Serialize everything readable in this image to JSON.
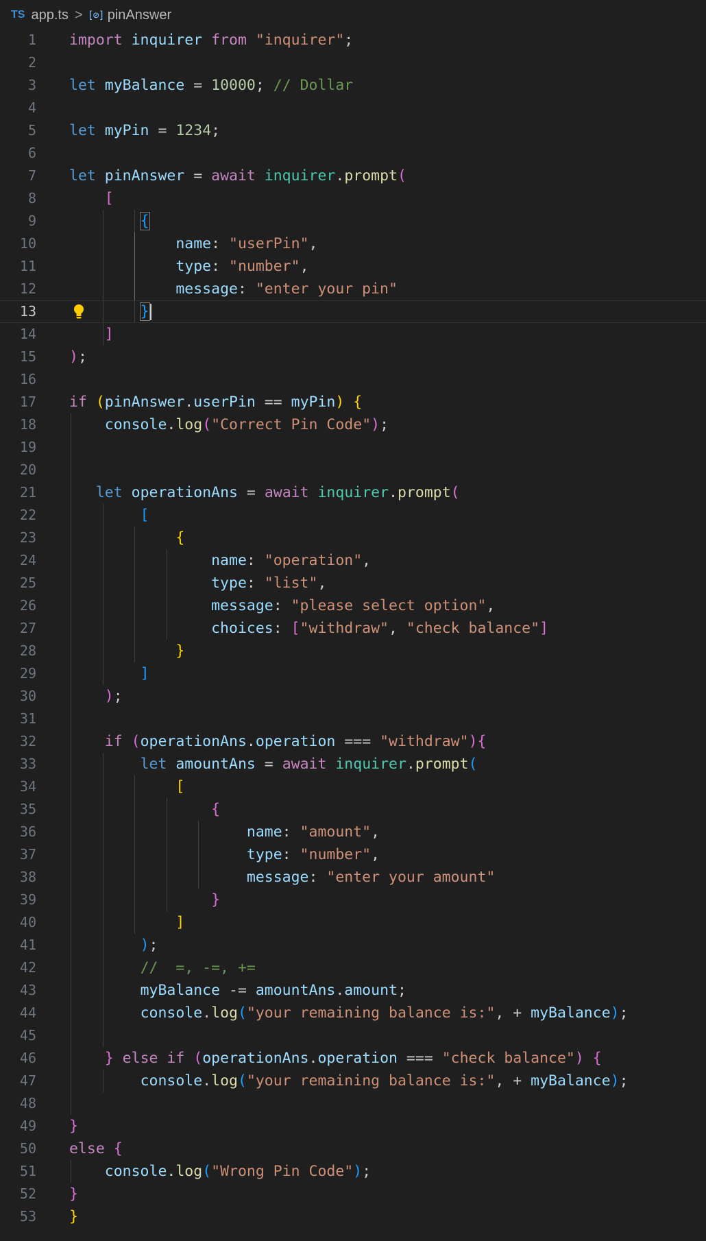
{
  "breadcrumb": {
    "file_icon": "TS",
    "file_name": "app.ts",
    "separator": ">",
    "symbol_icon": "[⊘]",
    "symbol_name": "pinAnswer"
  },
  "editor": {
    "current_line": 13,
    "colors": {
      "background": "#1f1f1f",
      "keyword": "#569cd6",
      "control": "#c586c0",
      "variable": "#9cdcfe",
      "function": "#dcdcaa",
      "type": "#4ec9b0",
      "string": "#ce9178",
      "number": "#b5cea8",
      "comment": "#6a9955",
      "bracket_gold": "#ffd700",
      "bracket_pink": "#da70d6",
      "bracket_blue": "#179fff"
    },
    "lines": [
      {
        "n": "1",
        "tokens": [
          [
            "import ",
            "c"
          ],
          [
            "inquirer ",
            "v"
          ],
          [
            "from ",
            "c"
          ],
          [
            "\"inquirer\"",
            "s"
          ],
          [
            ";",
            "p"
          ]
        ]
      },
      {
        "n": "2",
        "tokens": []
      },
      {
        "n": "3",
        "tokens": [
          [
            "let ",
            "k"
          ],
          [
            "myBalance",
            "v"
          ],
          [
            " = ",
            "p"
          ],
          [
            "10000",
            "n"
          ],
          [
            "; ",
            "p"
          ],
          [
            "// Dollar",
            "m"
          ]
        ]
      },
      {
        "n": "4",
        "tokens": []
      },
      {
        "n": "5",
        "tokens": [
          [
            "let ",
            "k"
          ],
          [
            "myPin",
            "v"
          ],
          [
            " = ",
            "p"
          ],
          [
            "1234",
            "n"
          ],
          [
            ";",
            "p"
          ]
        ]
      },
      {
        "n": "6",
        "tokens": []
      },
      {
        "n": "7",
        "tokens": [
          [
            "let ",
            "k"
          ],
          [
            "pinAnswer",
            "v"
          ],
          [
            " = ",
            "p"
          ],
          [
            "await ",
            "c"
          ],
          [
            "inquirer",
            "t"
          ],
          [
            ".",
            "p"
          ],
          [
            "prompt",
            "f"
          ],
          [
            "(",
            "b2"
          ]
        ]
      },
      {
        "n": "8",
        "tokens": [
          [
            "    ",
            "p"
          ],
          [
            "[",
            "b2"
          ]
        ]
      },
      {
        "n": "9",
        "tokens": [
          [
            "        ",
            "p"
          ],
          [
            "{",
            "b3box"
          ]
        ]
      },
      {
        "n": "10",
        "tokens": [
          [
            "            ",
            "p"
          ],
          [
            "name",
            "v"
          ],
          [
            ": ",
            "p"
          ],
          [
            "\"userPin\"",
            "s"
          ],
          [
            ",",
            "p"
          ]
        ]
      },
      {
        "n": "11",
        "tokens": [
          [
            "            ",
            "p"
          ],
          [
            "type",
            "v"
          ],
          [
            ": ",
            "p"
          ],
          [
            "\"number\"",
            "s"
          ],
          [
            ",",
            "p"
          ]
        ]
      },
      {
        "n": "12",
        "tokens": [
          [
            "            ",
            "p"
          ],
          [
            "message",
            "v"
          ],
          [
            ": ",
            "p"
          ],
          [
            "\"enter your pin\"",
            "s"
          ]
        ]
      },
      {
        "n": "13",
        "tokens": [
          [
            "        ",
            "p"
          ],
          [
            "}",
            "b3box"
          ],
          [
            "",
            "cursor"
          ]
        ]
      },
      {
        "n": "14",
        "tokens": [
          [
            "    ",
            "p"
          ],
          [
            "]",
            "b2"
          ]
        ]
      },
      {
        "n": "15",
        "tokens": [
          [
            ")",
            "b2"
          ],
          [
            ";",
            "p"
          ]
        ]
      },
      {
        "n": "16",
        "tokens": []
      },
      {
        "n": "17",
        "tokens": [
          [
            "if ",
            "c"
          ],
          [
            "(",
            "b1"
          ],
          [
            "pinAnswer",
            "v"
          ],
          [
            ".",
            "p"
          ],
          [
            "userPin",
            "v"
          ],
          [
            " == ",
            "p"
          ],
          [
            "myPin",
            "v"
          ],
          [
            ")",
            "b1"
          ],
          [
            " ",
            "p"
          ],
          [
            "{",
            "b1"
          ]
        ]
      },
      {
        "n": "18",
        "tokens": [
          [
            "    ",
            "p"
          ],
          [
            "console",
            "v"
          ],
          [
            ".",
            "p"
          ],
          [
            "log",
            "f"
          ],
          [
            "(",
            "b2"
          ],
          [
            "\"Correct Pin Code\"",
            "s"
          ],
          [
            ")",
            "b2"
          ],
          [
            ";",
            "p"
          ]
        ]
      },
      {
        "n": "19",
        "tokens": []
      },
      {
        "n": "20",
        "tokens": []
      },
      {
        "n": "21",
        "tokens": [
          [
            "   ",
            "p"
          ],
          [
            "let ",
            "k"
          ],
          [
            "operationAns",
            "v"
          ],
          [
            " = ",
            "p"
          ],
          [
            "await ",
            "c"
          ],
          [
            "inquirer",
            "t"
          ],
          [
            ".",
            "p"
          ],
          [
            "prompt",
            "f"
          ],
          [
            "(",
            "b2"
          ]
        ]
      },
      {
        "n": "22",
        "tokens": [
          [
            "        ",
            "p"
          ],
          [
            "[",
            "b3"
          ]
        ]
      },
      {
        "n": "23",
        "tokens": [
          [
            "            ",
            "p"
          ],
          [
            "{",
            "b1"
          ]
        ]
      },
      {
        "n": "24",
        "tokens": [
          [
            "                ",
            "p"
          ],
          [
            "name",
            "v"
          ],
          [
            ": ",
            "p"
          ],
          [
            "\"operation\"",
            "s"
          ],
          [
            ",",
            "p"
          ]
        ]
      },
      {
        "n": "25",
        "tokens": [
          [
            "                ",
            "p"
          ],
          [
            "type",
            "v"
          ],
          [
            ": ",
            "p"
          ],
          [
            "\"list\"",
            "s"
          ],
          [
            ",",
            "p"
          ]
        ]
      },
      {
        "n": "26",
        "tokens": [
          [
            "                ",
            "p"
          ],
          [
            "message",
            "v"
          ],
          [
            ": ",
            "p"
          ],
          [
            "\"please select option\"",
            "s"
          ],
          [
            ",",
            "p"
          ]
        ]
      },
      {
        "n": "27",
        "tokens": [
          [
            "                ",
            "p"
          ],
          [
            "choices",
            "v"
          ],
          [
            ": ",
            "p"
          ],
          [
            "[",
            "b2"
          ],
          [
            "\"withdraw\"",
            "s"
          ],
          [
            ", ",
            "p"
          ],
          [
            "\"check balance\"",
            "s"
          ],
          [
            "]",
            "b2"
          ]
        ]
      },
      {
        "n": "28",
        "tokens": [
          [
            "            ",
            "p"
          ],
          [
            "}",
            "b1"
          ]
        ]
      },
      {
        "n": "29",
        "tokens": [
          [
            "        ",
            "p"
          ],
          [
            "]",
            "b3"
          ]
        ]
      },
      {
        "n": "30",
        "tokens": [
          [
            "    ",
            "p"
          ],
          [
            ")",
            "b2"
          ],
          [
            ";",
            "p"
          ]
        ]
      },
      {
        "n": "31",
        "tokens": []
      },
      {
        "n": "32",
        "tokens": [
          [
            "    ",
            "p"
          ],
          [
            "if ",
            "c"
          ],
          [
            "(",
            "b2"
          ],
          [
            "operationAns",
            "v"
          ],
          [
            ".",
            "p"
          ],
          [
            "operation",
            "v"
          ],
          [
            " === ",
            "p"
          ],
          [
            "\"withdraw\"",
            "s"
          ],
          [
            ")",
            "b2"
          ],
          [
            "{",
            "b2"
          ]
        ]
      },
      {
        "n": "33",
        "tokens": [
          [
            "        ",
            "p"
          ],
          [
            "let ",
            "k"
          ],
          [
            "amountAns",
            "v"
          ],
          [
            " = ",
            "p"
          ],
          [
            "await ",
            "c"
          ],
          [
            "inquirer",
            "t"
          ],
          [
            ".",
            "p"
          ],
          [
            "prompt",
            "f"
          ],
          [
            "(",
            "b3"
          ]
        ]
      },
      {
        "n": "34",
        "tokens": [
          [
            "            ",
            "p"
          ],
          [
            "[",
            "b1"
          ]
        ]
      },
      {
        "n": "35",
        "tokens": [
          [
            "                ",
            "p"
          ],
          [
            "{",
            "b2"
          ]
        ]
      },
      {
        "n": "36",
        "tokens": [
          [
            "                    ",
            "p"
          ],
          [
            "name",
            "v"
          ],
          [
            ": ",
            "p"
          ],
          [
            "\"amount\"",
            "s"
          ],
          [
            ",",
            "p"
          ]
        ]
      },
      {
        "n": "37",
        "tokens": [
          [
            "                    ",
            "p"
          ],
          [
            "type",
            "v"
          ],
          [
            ": ",
            "p"
          ],
          [
            "\"number\"",
            "s"
          ],
          [
            ",",
            "p"
          ]
        ]
      },
      {
        "n": "38",
        "tokens": [
          [
            "                    ",
            "p"
          ],
          [
            "message",
            "v"
          ],
          [
            ": ",
            "p"
          ],
          [
            "\"enter your amount\"",
            "s"
          ]
        ]
      },
      {
        "n": "39",
        "tokens": [
          [
            "                ",
            "p"
          ],
          [
            "}",
            "b2"
          ]
        ]
      },
      {
        "n": "40",
        "tokens": [
          [
            "            ",
            "p"
          ],
          [
            "]",
            "b1"
          ]
        ]
      },
      {
        "n": "41",
        "tokens": [
          [
            "        ",
            "p"
          ],
          [
            ")",
            "b3"
          ],
          [
            ";",
            "p"
          ]
        ]
      },
      {
        "n": "42",
        "tokens": [
          [
            "        ",
            "p"
          ],
          [
            "//  =, -=, +=",
            "m"
          ]
        ]
      },
      {
        "n": "43",
        "tokens": [
          [
            "        ",
            "p"
          ],
          [
            "myBalance",
            "v"
          ],
          [
            " -= ",
            "p"
          ],
          [
            "amountAns",
            "v"
          ],
          [
            ".",
            "p"
          ],
          [
            "amount",
            "v"
          ],
          [
            ";",
            "p"
          ]
        ]
      },
      {
        "n": "44",
        "tokens": [
          [
            "        ",
            "p"
          ],
          [
            "console",
            "v"
          ],
          [
            ".",
            "p"
          ],
          [
            "log",
            "f"
          ],
          [
            "(",
            "b3"
          ],
          [
            "\"your remaining balance is:\"",
            "s"
          ],
          [
            ", + ",
            "p"
          ],
          [
            "myBalance",
            "v"
          ],
          [
            ")",
            "b3"
          ],
          [
            ";",
            "p"
          ]
        ]
      },
      {
        "n": "45",
        "tokens": []
      },
      {
        "n": "46",
        "tokens": [
          [
            "    ",
            "p"
          ],
          [
            "}",
            "b2"
          ],
          [
            " else if ",
            "c"
          ],
          [
            "(",
            "b2"
          ],
          [
            "operationAns",
            "v"
          ],
          [
            ".",
            "p"
          ],
          [
            "operation",
            "v"
          ],
          [
            " === ",
            "p"
          ],
          [
            "\"check balance\"",
            "s"
          ],
          [
            ")",
            "b2"
          ],
          [
            " ",
            "p"
          ],
          [
            "{",
            "b2"
          ]
        ]
      },
      {
        "n": "47",
        "tokens": [
          [
            "        ",
            "p"
          ],
          [
            "console",
            "v"
          ],
          [
            ".",
            "p"
          ],
          [
            "log",
            "f"
          ],
          [
            "(",
            "b3"
          ],
          [
            "\"your remaining balance is:\"",
            "s"
          ],
          [
            ", + ",
            "p"
          ],
          [
            "myBalance",
            "v"
          ],
          [
            ")",
            "b3"
          ],
          [
            ";",
            "p"
          ]
        ]
      },
      {
        "n": "48",
        "tokens": []
      },
      {
        "n": "49",
        "tokens": [
          [
            "}",
            "b2"
          ]
        ]
      },
      {
        "n": "50",
        "tokens": [
          [
            "else ",
            "c"
          ],
          [
            "{",
            "b2"
          ]
        ]
      },
      {
        "n": "51",
        "tokens": [
          [
            "    ",
            "p"
          ],
          [
            "console",
            "v"
          ],
          [
            ".",
            "p"
          ],
          [
            "log",
            "f"
          ],
          [
            "(",
            "b3"
          ],
          [
            "\"Wrong Pin Code\"",
            "s"
          ],
          [
            ")",
            "b3"
          ],
          [
            ";",
            "p"
          ]
        ]
      },
      {
        "n": "52",
        "tokens": [
          [
            "}",
            "b2"
          ]
        ]
      },
      {
        "n": "53",
        "tokens": [
          [
            "}",
            "b1"
          ]
        ]
      }
    ]
  }
}
